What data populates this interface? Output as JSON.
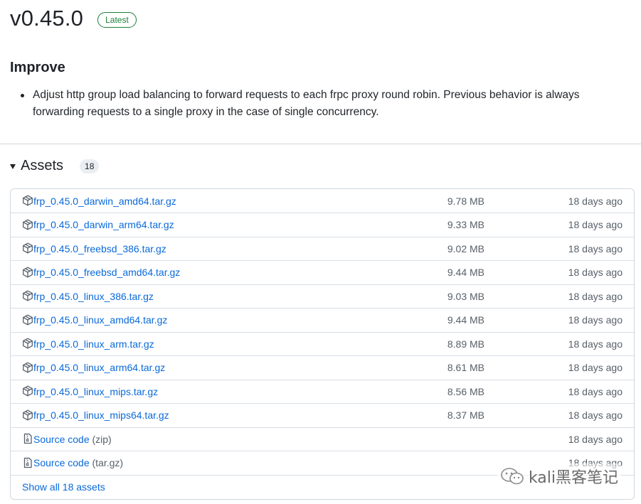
{
  "release": {
    "version": "v0.45.0",
    "badge": "Latest"
  },
  "notes": {
    "heading": "Improve",
    "items": [
      "Adjust http group load balancing to forward requests to each frpc proxy round robin. Previous behavior is always forwarding requests to a single proxy in the case of single concurrency."
    ]
  },
  "assets": {
    "label": "Assets",
    "count": "18",
    "rows": [
      {
        "name": "frp_0.45.0_darwin_amd64.tar.gz",
        "size": "9.78 MB",
        "date": "18 days ago",
        "icon": "package-icon"
      },
      {
        "name": "frp_0.45.0_darwin_arm64.tar.gz",
        "size": "9.33 MB",
        "date": "18 days ago",
        "icon": "package-icon"
      },
      {
        "name": "frp_0.45.0_freebsd_386.tar.gz",
        "size": "9.02 MB",
        "date": "18 days ago",
        "icon": "package-icon"
      },
      {
        "name": "frp_0.45.0_freebsd_amd64.tar.gz",
        "size": "9.44 MB",
        "date": "18 days ago",
        "icon": "package-icon"
      },
      {
        "name": "frp_0.45.0_linux_386.tar.gz",
        "size": "9.03 MB",
        "date": "18 days ago",
        "icon": "package-icon"
      },
      {
        "name": "frp_0.45.0_linux_amd64.tar.gz",
        "size": "9.44 MB",
        "date": "18 days ago",
        "icon": "package-icon"
      },
      {
        "name": "frp_0.45.0_linux_arm.tar.gz",
        "size": "8.89 MB",
        "date": "18 days ago",
        "icon": "package-icon"
      },
      {
        "name": "frp_0.45.0_linux_arm64.tar.gz",
        "size": "8.61 MB",
        "date": "18 days ago",
        "icon": "package-icon"
      },
      {
        "name": "frp_0.45.0_linux_mips.tar.gz",
        "size": "8.56 MB",
        "date": "18 days ago",
        "icon": "package-icon"
      },
      {
        "name": "frp_0.45.0_linux_mips64.tar.gz",
        "size": "8.37 MB",
        "date": "18 days ago",
        "icon": "package-icon"
      }
    ],
    "source_rows": [
      {
        "name": "Source code",
        "ext": "(zip)",
        "date": "18 days ago",
        "icon": "file-zip-icon"
      },
      {
        "name": "Source code",
        "ext": "(tar.gz)",
        "date": "18 days ago",
        "icon": "file-zip-icon"
      }
    ],
    "show_all": "Show all 18 assets"
  },
  "watermark": {
    "text": "kali黑客笔记",
    "icon": "wechat-icon"
  },
  "colors": {
    "link": "#0969da",
    "muted": "#57606a",
    "latest_green": "#1a7f37",
    "border": "#d0d7de"
  }
}
